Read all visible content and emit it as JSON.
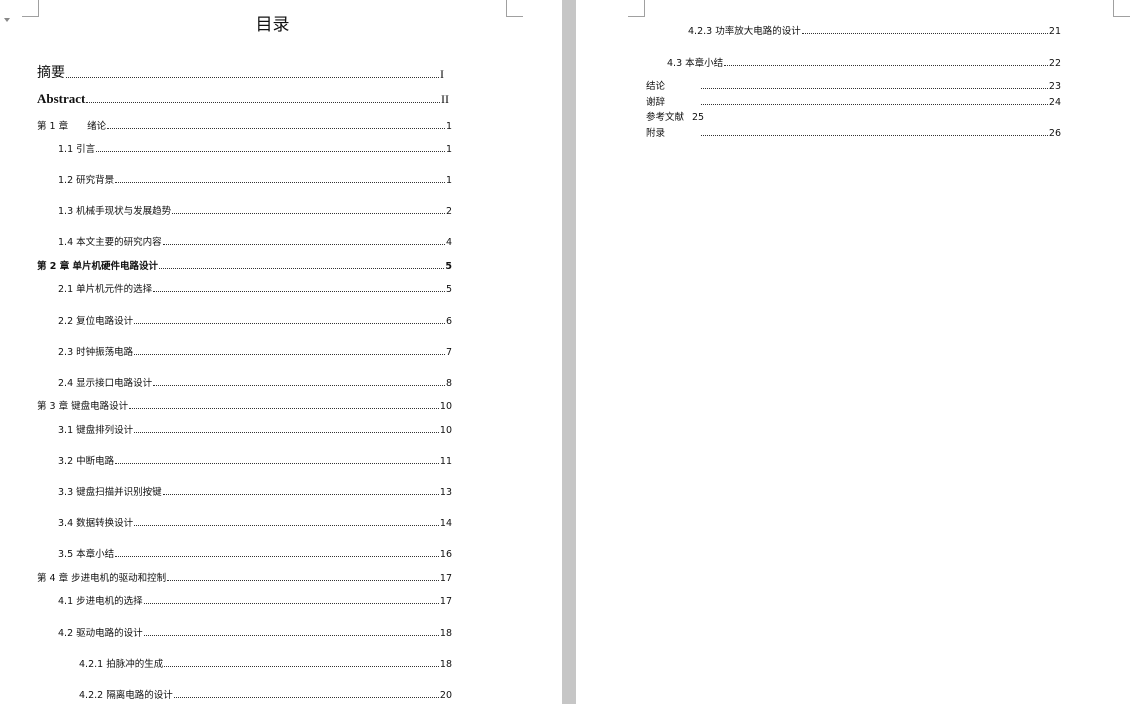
{
  "left_page": {
    "title": "目录",
    "entries": [
      {
        "text": "摘要",
        "page": "I"
      },
      {
        "text": "Abstract",
        "page": "II"
      },
      {
        "text": "第 1 章　　绪论",
        "page": "1"
      },
      {
        "text": "1.1 引言",
        "page": "1"
      },
      {
        "text": "1.2 研究背景",
        "page": "1"
      },
      {
        "text": "1.3 机械手现状与发展趋势",
        "page": "2"
      },
      {
        "text": "1.4 本文主要的研究内容",
        "page": "4"
      },
      {
        "text": "第 2 章 单片机硬件电路设计",
        "page": "5"
      },
      {
        "text": "2.1 单片机元件的选择",
        "page": "5"
      },
      {
        "text": "2.2 复位电路设计",
        "page": "6"
      },
      {
        "text": "2.3 时钟振荡电路",
        "page": "7"
      },
      {
        "text": "2.4 显示接口电路设计",
        "page": "8"
      },
      {
        "text": "第 3 章 键盘电路设计",
        "page": "10"
      },
      {
        "text": "3.1 键盘排列设计",
        "page": "10"
      },
      {
        "text": "3.2 中断电路",
        "page": "11"
      },
      {
        "text": "3.3 键盘扫描并识别按键",
        "page": "13"
      },
      {
        "text": "3.4 数据转换设计",
        "page": "14"
      },
      {
        "text": "3.5 本章小结",
        "page": "16"
      },
      {
        "text": "第 4 章 步进电机的驱动和控制",
        "page": "17"
      },
      {
        "text": "4.1 步进电机的选择",
        "page": "17"
      },
      {
        "text": "4.2 驱动电路的设计",
        "page": "18"
      },
      {
        "text": "4.2.1 拍脉冲的生成",
        "page": "18"
      },
      {
        "text": "4.2.2 隔离电路的设计",
        "page": "20"
      }
    ]
  },
  "right_page": {
    "entries": [
      {
        "text": "4.2.3 功率放大电路的设计",
        "page": "21"
      },
      {
        "text": "4.3 本章小结",
        "page": "22"
      },
      {
        "text": "结论",
        "page": "23"
      },
      {
        "text": "谢辞",
        "page": "24"
      },
      {
        "text": "参考文献",
        "page": "25"
      },
      {
        "text": "附录",
        "page": "26"
      }
    ]
  }
}
